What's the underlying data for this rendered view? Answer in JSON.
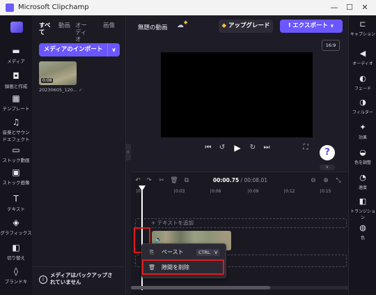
{
  "window": {
    "title": "Microsoft Clipchamp",
    "controls": [
      "—",
      "☐",
      "✕"
    ]
  },
  "left_nav": [
    {
      "label": "メディア",
      "icon": "folder-icon",
      "glyph": "▬"
    },
    {
      "label": "録画と作成",
      "icon": "video-camera-icon",
      "glyph": "◘"
    },
    {
      "label": "テンプレート",
      "icon": "templates-icon",
      "glyph": "▦"
    },
    {
      "label": "音楽とサウンドエフェクト",
      "icon": "music-note-icon",
      "glyph": "♫"
    },
    {
      "label": "ストック動画",
      "icon": "stock-video-icon",
      "glyph": "▭"
    },
    {
      "label": "ストック画像",
      "icon": "stock-image-icon",
      "glyph": "▣"
    },
    {
      "label": "テキスト",
      "icon": "text-icon",
      "glyph": "T"
    },
    {
      "label": "グラフィックス",
      "icon": "graphics-icon",
      "glyph": "◈"
    },
    {
      "label": "切り替え",
      "icon": "transition-icon",
      "glyph": "◧"
    },
    {
      "label": "ブランドキ",
      "icon": "brand-kit-icon",
      "glyph": "◊"
    }
  ],
  "media_panel": {
    "tabs": [
      "すべて",
      "動画",
      "オーディオ",
      "画像"
    ],
    "import_label": "メディアのインポート",
    "import_dropdown": "∨",
    "items": [
      {
        "duration": "0:08",
        "name": "20230605_120..."
      }
    ],
    "backup_text": "メディアはバックアップされていません"
  },
  "topbar": {
    "project_name": "無題の動画",
    "upgrade_label": "アップグレード",
    "export_label": "エクスポート",
    "aspect_ratio": "16:9"
  },
  "player": {
    "help": "?"
  },
  "timeline": {
    "current_time": "00:00.75",
    "total_time": "00:08.01",
    "ticks": [
      "0",
      "0:03",
      "0:06",
      "0:09",
      "0:12",
      "0:15",
      "0:18"
    ],
    "text_lane_placeholder": "+ テキストを追加"
  },
  "context_menu": {
    "paste_label": "ペースト",
    "paste_shortcut_ctrl": "CTRL",
    "paste_shortcut_key": "V",
    "delete_gap_label": "隙間を削除"
  },
  "right_panel": [
    {
      "label": "キャプション",
      "icon": "captions-icon",
      "glyph": "⊏"
    },
    {
      "label": "オーディオ",
      "icon": "speaker-icon",
      "glyph": "◀"
    },
    {
      "label": "フェード",
      "icon": "fade-icon",
      "glyph": "◐"
    },
    {
      "label": "フィルター",
      "icon": "filter-icon",
      "glyph": "◑"
    },
    {
      "label": "効果",
      "icon": "effects-wand-icon",
      "glyph": "✦"
    },
    {
      "label": "色を調整",
      "icon": "color-adjust-icon",
      "glyph": "◒"
    },
    {
      "label": "速度",
      "icon": "speed-gauge-icon",
      "glyph": "◔"
    },
    {
      "label": "トランジション",
      "icon": "transition-icon",
      "glyph": "◧"
    },
    {
      "label": "色",
      "icon": "color-palette-icon",
      "glyph": "◍"
    }
  ],
  "colors": {
    "accent": "#6b57ff",
    "highlight_box": "#e01b1b",
    "background": "#1e1d27"
  }
}
